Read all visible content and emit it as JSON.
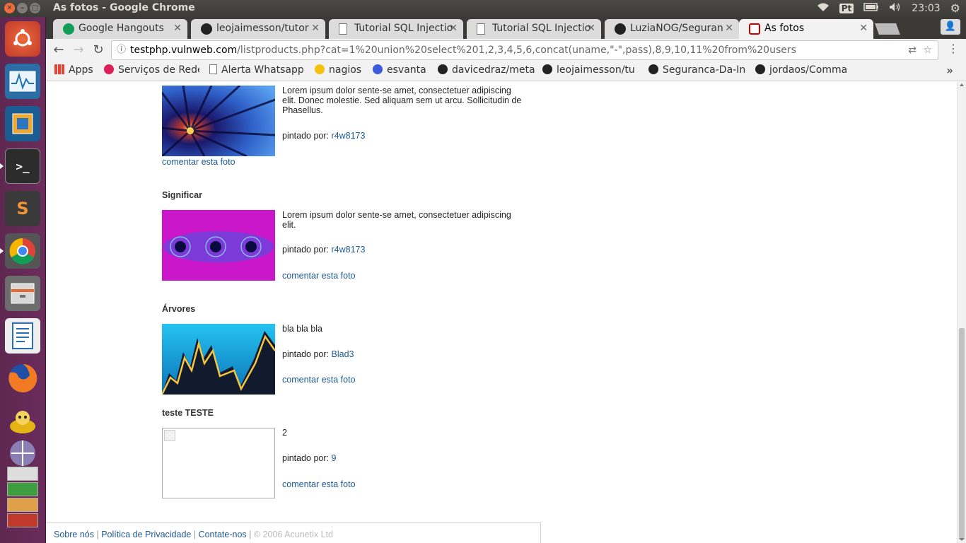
{
  "os": {
    "window_title": "As fotos - Google Chrome",
    "keyboard_layout": "Pt",
    "clock": "23:03",
    "icons": [
      "wifi-icon",
      "battery-icon",
      "volume-icon",
      "settings-gear-icon"
    ]
  },
  "launcher": {
    "items": [
      "ubuntu-dash",
      "system-monitor",
      "virtualbox",
      "terminal",
      "sublime-text",
      "chrome",
      "file-manager",
      "libreoffice-writer",
      "firefox",
      "genie-app",
      "workspace-switcher",
      "stacked-apps"
    ]
  },
  "tabs": [
    {
      "label": "Google Hangouts",
      "icon": "hangouts-icon",
      "color": "#0f9d58"
    },
    {
      "label": "leojaimesson/tutor",
      "icon": "github-icon",
      "color": "#222222"
    },
    {
      "label": "Tutorial SQL Injectio",
      "icon": "document-icon",
      "color": "#777777"
    },
    {
      "label": "Tutorial SQL Injectio",
      "icon": "document-icon",
      "color": "#777777"
    },
    {
      "label": "LuziaNOG/Seguran",
      "icon": "github-icon",
      "color": "#222222"
    },
    {
      "label": "As fotos",
      "icon": "acunetix-icon",
      "color": "#cc0000"
    }
  ],
  "toolbar": {
    "url_host": "testphp.vulnweb.com",
    "url_path": "/listproducts.php?cat=1%20union%20select%201,2,3,4,5,6,concat(uname,\"-\",pass),8,9,10,11%20from%20users"
  },
  "bookmarks": [
    {
      "label": "Apps",
      "color": "#e94235"
    },
    {
      "label": "Serviços de Rede",
      "color": "#e01e5a"
    },
    {
      "label": "Alerta Whatsapp",
      "color": "#777777"
    },
    {
      "label": "nagios",
      "color": "#f4c20d"
    },
    {
      "label": "esvanta",
      "color": "#3b5bdb"
    },
    {
      "label": "davicedraz/meta",
      "color": "#222222"
    },
    {
      "label": "leojaimesson/tu",
      "color": "#222222"
    },
    {
      "label": "Seguranca-Da-In",
      "color": "#222222"
    },
    {
      "label": "jordaos/Comma",
      "color": "#222222"
    }
  ],
  "page": {
    "products": [
      {
        "title": "",
        "description": "Lorem ipsum dolor sente-se amet, consectetuer adipiscing elit. Donec molestie. Sed aliquam sem ut arcu. Sollicitudin de Phasellus.",
        "painted_label": "pintado por:",
        "author": "r4w8173",
        "comment": "comentar esta foto"
      },
      {
        "title": "Significar",
        "description": "Lorem ipsum dolor sente-se amet, consectetuer adipiscing elit.",
        "painted_label": "pintado por:",
        "author": "r4w8173",
        "comment": "comentar esta foto"
      },
      {
        "title": "Árvores",
        "description": "bla bla bla",
        "painted_label": "pintado por:",
        "author": "Blad3",
        "comment": "comentar esta foto"
      },
      {
        "title": "teste TESTE",
        "description": "2",
        "painted_label": "pintado por:",
        "author": "9",
        "comment": "comentar esta foto"
      }
    ],
    "footer": {
      "about": "Sobre nós",
      "privacy": "Política de Privacidade",
      "contact": "Contate-nos",
      "copyright": "© 2006 Acunetix Ltd",
      "separator": "|"
    }
  }
}
